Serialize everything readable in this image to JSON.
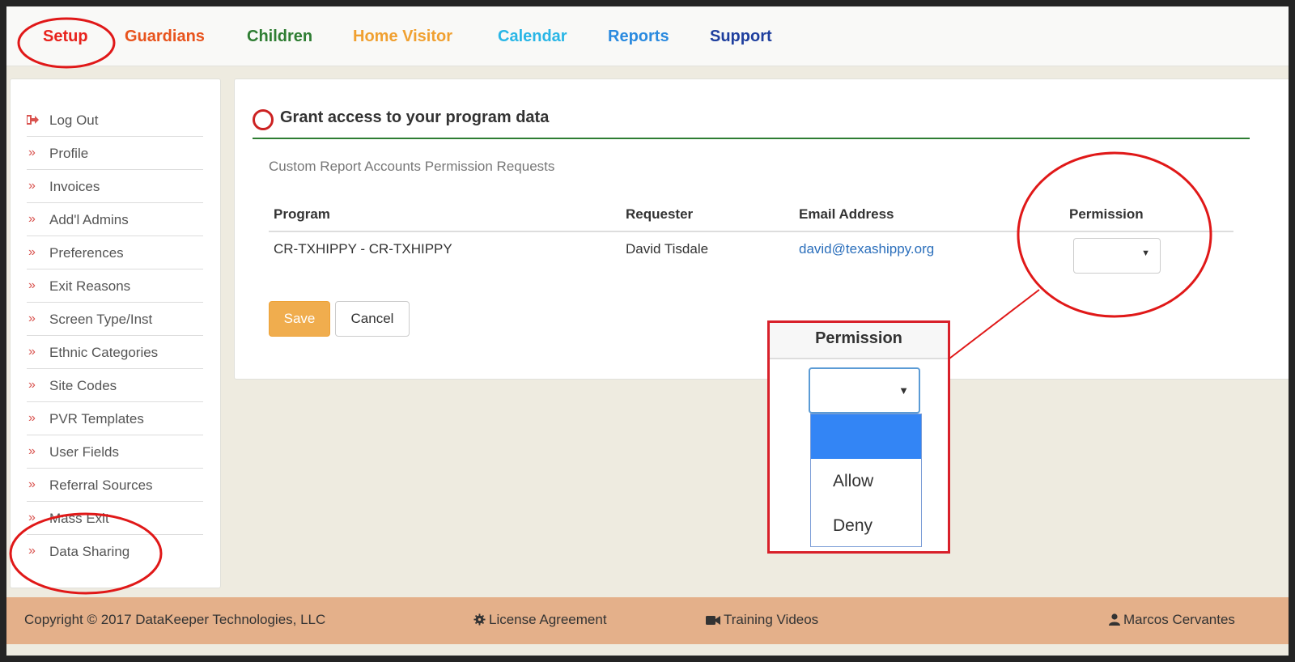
{
  "nav": {
    "items": [
      {
        "label": "Setup",
        "color": "#e8221c"
      },
      {
        "label": "Guardians",
        "color": "#e8531c"
      },
      {
        "label": "Children",
        "color": "#2e7d32"
      },
      {
        "label": "Home Visitor",
        "color": "#f0a030"
      },
      {
        "label": "Calendar",
        "color": "#29b6e6"
      },
      {
        "label": "Reports",
        "color": "#2a8adf"
      },
      {
        "label": "Support",
        "color": "#1f3f9e"
      }
    ]
  },
  "sidebar": {
    "items": [
      {
        "label": "Log Out",
        "icon": "logout-icon"
      },
      {
        "label": "Profile",
        "icon": "chevron-double-right-icon"
      },
      {
        "label": "Invoices",
        "icon": "chevron-double-right-icon"
      },
      {
        "label": "Add'l Admins",
        "icon": "chevron-double-right-icon"
      },
      {
        "label": "Preferences",
        "icon": "chevron-double-right-icon"
      },
      {
        "label": "Exit Reasons",
        "icon": "chevron-double-right-icon"
      },
      {
        "label": "Screen Type/Inst",
        "icon": "chevron-double-right-icon"
      },
      {
        "label": "Ethnic Categories",
        "icon": "chevron-double-right-icon"
      },
      {
        "label": "Site Codes",
        "icon": "chevron-double-right-icon"
      },
      {
        "label": "PVR Templates",
        "icon": "chevron-double-right-icon"
      },
      {
        "label": "User Fields",
        "icon": "chevron-double-right-icon"
      },
      {
        "label": "Referral Sources",
        "icon": "chevron-double-right-icon"
      },
      {
        "label": "Mass Exit",
        "icon": "chevron-double-right-icon"
      },
      {
        "label": "Data Sharing",
        "icon": "chevron-double-right-icon"
      }
    ],
    "chevron": "»"
  },
  "main": {
    "title": "Grant access to your program data",
    "subtitle": "Custom Report Accounts Permission Requests",
    "columns": [
      "Program",
      "Requester",
      "Email Address",
      "Permission"
    ],
    "rows": [
      {
        "program": "CR-TXHIPPY - CR-TXHIPPY",
        "requester": "David Tisdale",
        "email": "david@texashippy.org",
        "permission": ""
      }
    ],
    "save_label": "Save",
    "cancel_label": "Cancel"
  },
  "callout": {
    "header": "Permission",
    "options": [
      "",
      "Allow",
      "Deny"
    ],
    "highlighted_option": ""
  },
  "footer": {
    "copyright": "Copyright © 2017 DataKeeper Technologies, LLC",
    "license": "License Agreement",
    "training": "Training Videos",
    "user": "Marcos Cervantes"
  },
  "colors": {
    "annotation_red": "#e01818",
    "save_orange": "#f0ad4e",
    "footer_tan": "#e4b08a",
    "title_rule_green": "#2e7d32",
    "link_blue": "#2a6ebb",
    "selected_option_blue": "#3385f5"
  }
}
